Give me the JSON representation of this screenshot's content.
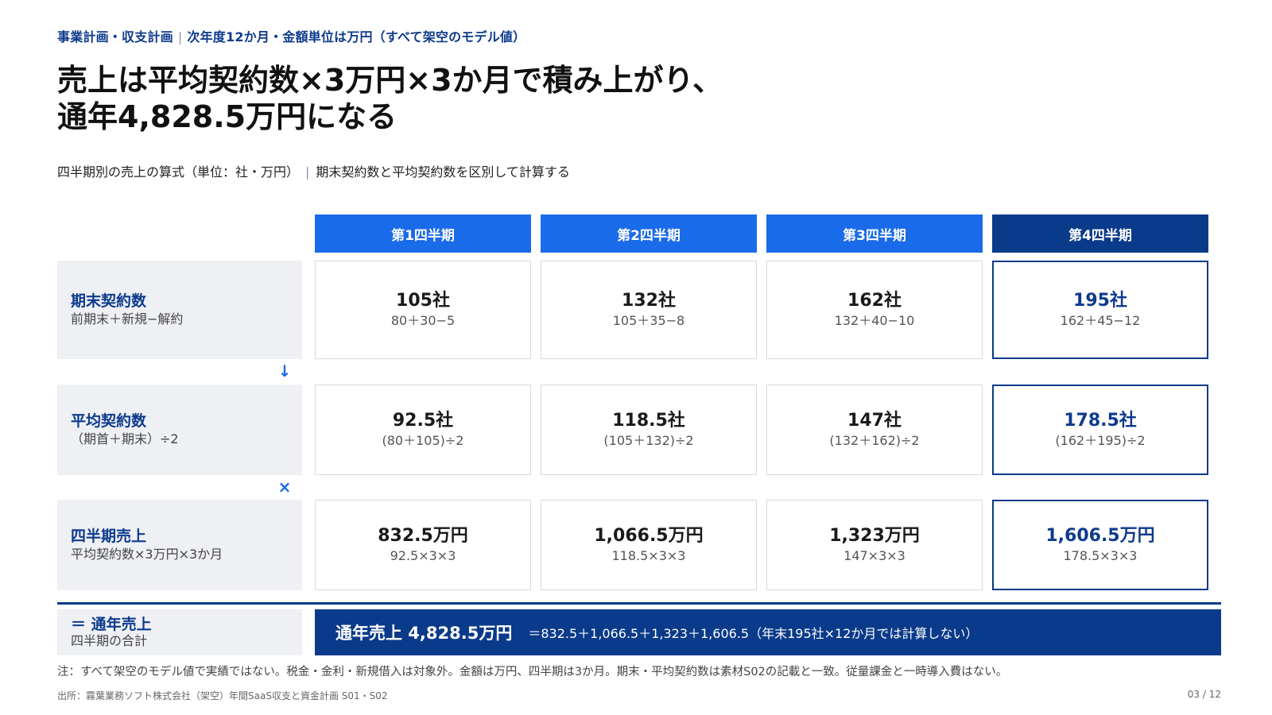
{
  "header": {
    "kicker_main": "事業計画・収支計画",
    "kicker_sub": "次年度12か月・金額単位は万円（すべて架空のモデル値）",
    "title_line1": "売上は平均契約数×3万円×3か月で積み上がり、",
    "title_line2": "通年4,828.5万円になる",
    "subtitle_main": "四半期別の売上の算式（単位：社・万円）",
    "subtitle_sub": "期末契約数と平均契約数を区別して計算する"
  },
  "quarters": [
    "第1四半期",
    "第2四半期",
    "第3四半期",
    "第4四半期"
  ],
  "rows": [
    {
      "label": "期末契約数",
      "sub": "前期末＋新規−解約",
      "values": [
        "105社",
        "132社",
        "162社",
        "195社"
      ],
      "formulas": [
        "80＋30−5",
        "105＋35−8",
        "132＋40−10",
        "162＋45−12"
      ]
    },
    {
      "label": "平均契約数",
      "sub": "（期首＋期末）÷2",
      "values": [
        "92.5社",
        "118.5社",
        "147社",
        "178.5社"
      ],
      "formulas": [
        "(80＋105)÷2",
        "(105＋132)÷2",
        "(132＋162)÷2",
        "(162＋195)÷2"
      ]
    },
    {
      "label": "四半期売上",
      "sub": "平均契約数×3万円×3か月",
      "values": [
        "832.5万円",
        "1,066.5万円",
        "1,323万円",
        "1,606.5万円"
      ],
      "formulas": [
        "92.5×3×3",
        "118.5×3×3",
        "147×3×3",
        "178.5×3×3"
      ]
    }
  ],
  "operators": {
    "arrow": "↓",
    "times": "×"
  },
  "total": {
    "label": "＝ 通年売上",
    "sub": "四半期の合計",
    "value": "通年売上 4,828.5万円",
    "formula": "＝832.5＋1,066.5＋1,323＋1,606.5（年末195社×12か月では計算しない）"
  },
  "footer": {
    "note": "注：すべて架空のモデル値で実績ではない。税金・金利・新規借入は対象外。金額は万円、四半期は3か月。期末・平均契約数は素材S02の記載と一致。従量課金と一時導入費はない。",
    "source": "出所：霧葉業務ソフト株式会社（架空）年間SaaS収支と資金計画 S01・S02",
    "page": "03 / 12"
  },
  "colors": {
    "accent": "#1a6bea",
    "navy": "#0a3a8a",
    "label_bg": "#eef0f4"
  }
}
